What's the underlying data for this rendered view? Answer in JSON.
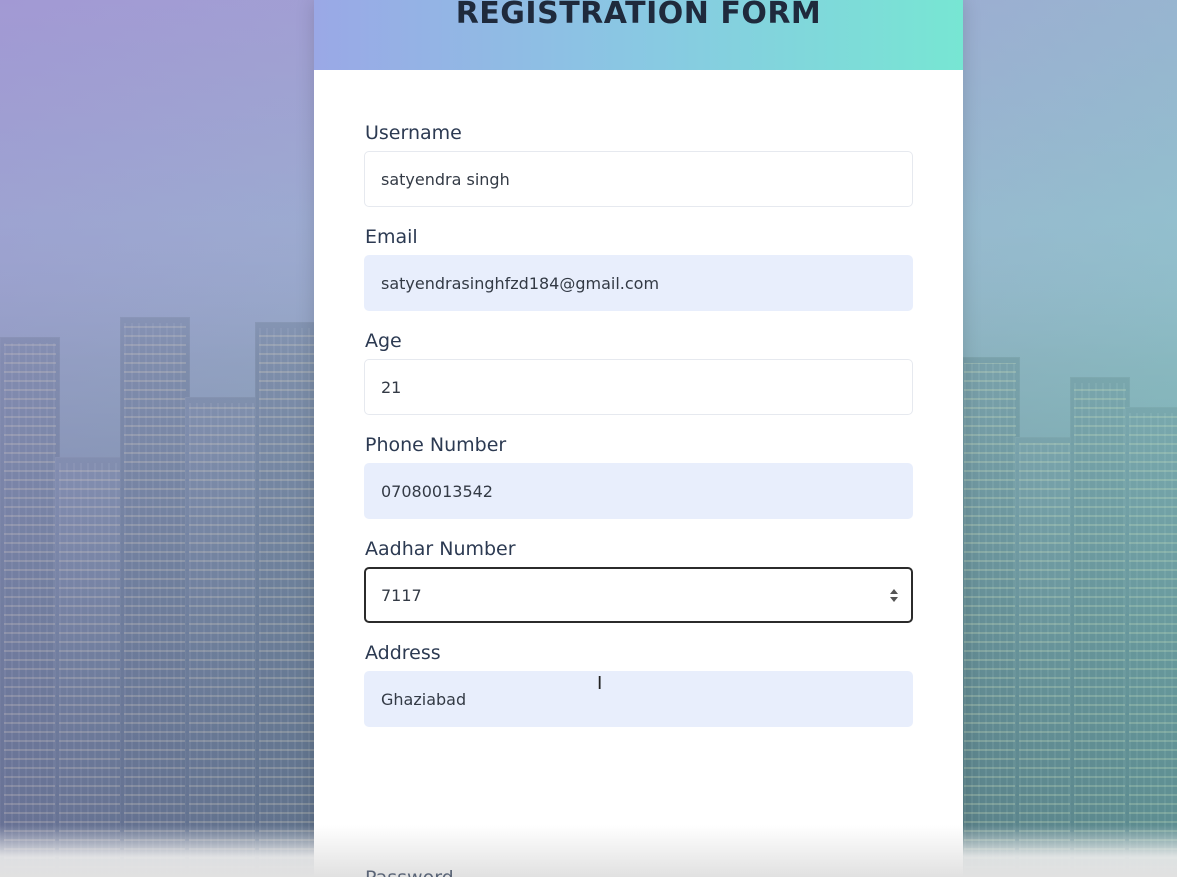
{
  "header": {
    "title": "REGISTRATION FORM"
  },
  "form": {
    "fields": [
      {
        "label": "Username",
        "value": "satyendra singh"
      },
      {
        "label": "Email",
        "value": "satyendrasinghfzd184@gmail.com"
      },
      {
        "label": "Age",
        "value": "21"
      },
      {
        "label": "Phone Number",
        "value": "07080013542"
      },
      {
        "label": "Aadhar Number",
        "value": "7117"
      },
      {
        "label": "Address",
        "value": "Ghaziabad"
      }
    ],
    "next_label": "Password"
  },
  "colors": {
    "header_gradient_start": "#9aa8e6",
    "header_gradient_end": "#77e6d3",
    "autofill_bg": "#e8eefc",
    "focus_border": "#2b2b2b"
  },
  "icons": {
    "cursor": "text-cursor-icon",
    "spinner": "number-spinner-icon"
  }
}
